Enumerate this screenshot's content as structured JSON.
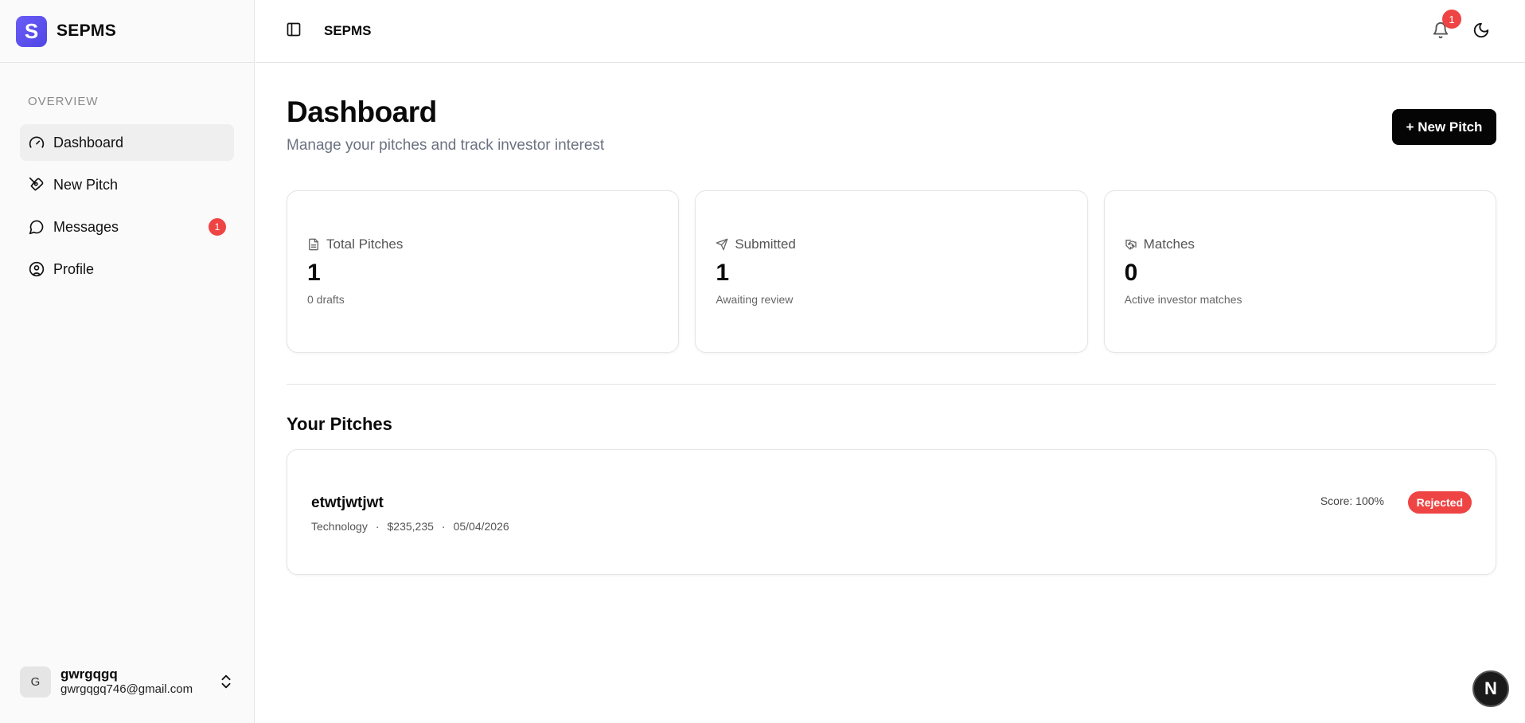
{
  "sidebar": {
    "logo_letter": "S",
    "brand": "SEPMS",
    "section_label": "OVERVIEW",
    "items": [
      {
        "label": "Dashboard",
        "icon": "gauge-icon",
        "active": true
      },
      {
        "label": "New Pitch",
        "icon": "pen-tool-icon"
      },
      {
        "label": "Messages",
        "icon": "message-circle-icon",
        "badge": "1"
      },
      {
        "label": "Profile",
        "icon": "user-circle-icon"
      }
    ],
    "user": {
      "initial": "G",
      "name": "gwrgqgq",
      "email": "gwrgqgq746@gmail.com"
    }
  },
  "topbar": {
    "title": "SEPMS",
    "notification_count": "1"
  },
  "main": {
    "title": "Dashboard",
    "subtitle": "Manage your pitches and track investor interest",
    "new_pitch_button": "+ New Pitch",
    "stats": [
      {
        "label": "Total Pitches",
        "value": "1",
        "sub": "0 drafts",
        "icon": "file-icon"
      },
      {
        "label": "Submitted",
        "value": "1",
        "sub": "Awaiting review",
        "icon": "send-icon"
      },
      {
        "label": "Matches",
        "value": "0",
        "sub": "Active investor matches",
        "icon": "handshake-icon"
      }
    ],
    "section_title": "Your Pitches",
    "pitches": [
      {
        "name": "etwtjwtjwt",
        "category": "Technology",
        "amount": "$235,235",
        "date": "05/04/2026",
        "score": "Score: 100%",
        "status": "Rejected"
      }
    ]
  },
  "fab": {
    "label": "N"
  },
  "colors": {
    "accent": "#4f46e5",
    "danger": "#ef4444",
    "primary_button": "#050505"
  }
}
